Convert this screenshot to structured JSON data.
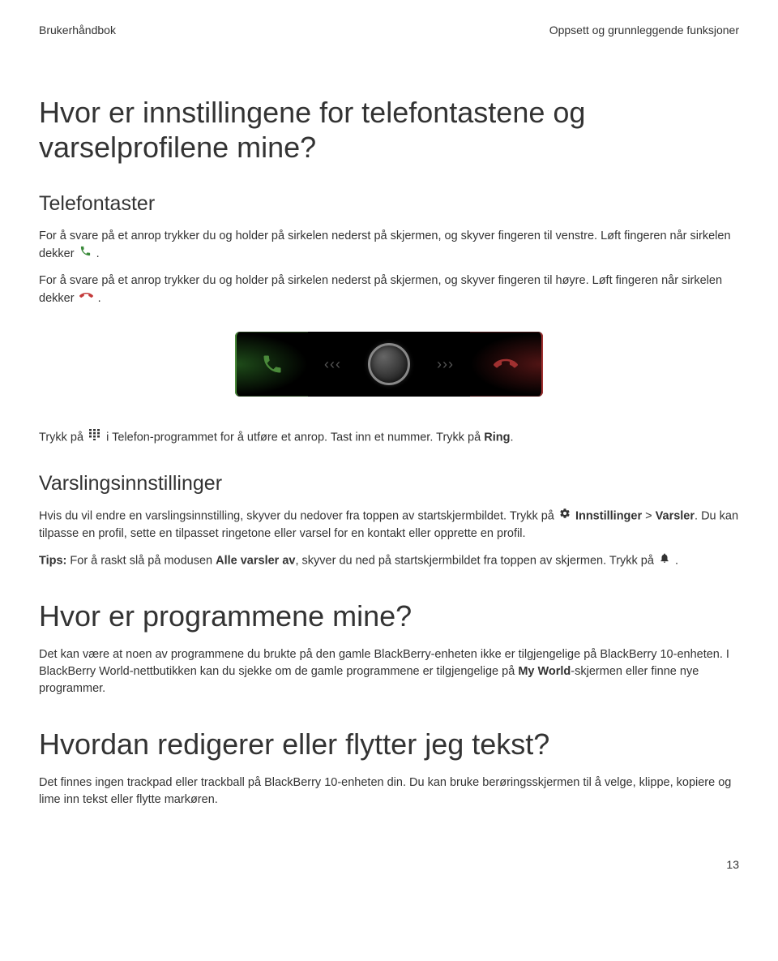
{
  "header": {
    "left": "Brukerhåndbok",
    "right": "Oppsett og grunnleggende funksjoner"
  },
  "h1": "Hvor er innstillingene for telefontastene og varselprofilene mine?",
  "telefontaster": {
    "title": "Telefontaster",
    "p1a": "For å svare på et anrop trykker du og holder på sirkelen nederst på skjermen, og skyver fingeren til venstre. Løft fingeren når sirkelen dekker ",
    "p1b": ".",
    "p2a": "For å svare på et anrop trykker du og holder på sirkelen nederst på skjermen, og skyver fingeren til høyre. Løft fingeren når sirkelen dekker ",
    "p2b": ".",
    "p3a": "Trykk på ",
    "p3b": " i Telefon-programmet for å utføre et anrop. Tast inn et nummer. Trykk på ",
    "p3c": "Ring",
    "p3d": "."
  },
  "varsling": {
    "title": "Varslingsinnstillinger",
    "p1a": "Hvis du vil endre en varslingsinnstilling, skyver du nedover fra toppen av startskjermbildet. Trykk på ",
    "p1b": "Innstillinger",
    "p1c": " > ",
    "p1d": "Varsler",
    "p1e": ". Du kan tilpasse en profil, sette en tilpasset ringetone eller varsel for en kontakt eller opprette en profil.",
    "p2a": "Tips:",
    "p2b": " For å raskt slå på modusen ",
    "p2c": "Alle varsler av",
    "p2d": ", skyver du ned på startskjermbildet fra toppen av skjermen. Trykk på ",
    "p2e": "."
  },
  "h2a": "Hvor er programmene mine?",
  "programmer_p": {
    "a": "Det kan være at noen av programmene du brukte på den gamle BlackBerry-enheten ikke er tilgjengelige på BlackBerry 10-enheten. I BlackBerry World-nettbutikken kan du sjekke om de gamle programmene er tilgjengelige på ",
    "b": "My World",
    "c": "-skjermen eller finne nye programmer."
  },
  "h2b": "Hvordan redigerer eller flytter jeg tekst?",
  "rediger_p": "Det finnes ingen trackpad eller trackball på BlackBerry 10-enheten din. Du kan bruke berøringsskjermen til å velge, klippe, kopiere og lime inn tekst eller flytte markøren.",
  "page_number": "13"
}
